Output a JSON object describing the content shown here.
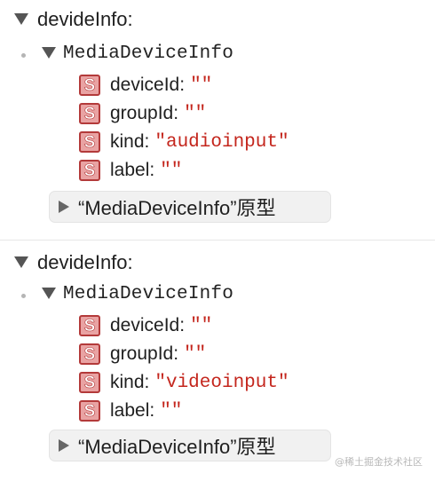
{
  "entries": [
    {
      "label": "devideInfo:",
      "class_name": "MediaDeviceInfo",
      "properties": [
        {
          "badge": "S",
          "key": "deviceId:",
          "value": "\"\""
        },
        {
          "badge": "S",
          "key": "groupId:",
          "value": "\"\""
        },
        {
          "badge": "S",
          "key": "kind:",
          "value": "\"audioinput\""
        },
        {
          "badge": "S",
          "key": "label:",
          "value": "\"\""
        }
      ],
      "prototype_label": "“MediaDeviceInfo”原型"
    },
    {
      "label": "devideInfo:",
      "class_name": "MediaDeviceInfo",
      "properties": [
        {
          "badge": "S",
          "key": "deviceId:",
          "value": "\"\""
        },
        {
          "badge": "S",
          "key": "groupId:",
          "value": "\"\""
        },
        {
          "badge": "S",
          "key": "kind:",
          "value": "\"videoinput\""
        },
        {
          "badge": "S",
          "key": "label:",
          "value": "\"\""
        }
      ],
      "prototype_label": "“MediaDeviceInfo”原型"
    }
  ],
  "watermark": "@稀土掘金技术社区",
  "icons": {
    "expanded": "triangle-down-icon",
    "collapsed": "triangle-right-icon",
    "string_badge": "string-type-badge-icon"
  },
  "colors": {
    "string_value": "#c4261d",
    "badge_fill": "#e9a3a3",
    "badge_border": "#b33a3a",
    "prototype_bg": "#f1f1f1"
  }
}
